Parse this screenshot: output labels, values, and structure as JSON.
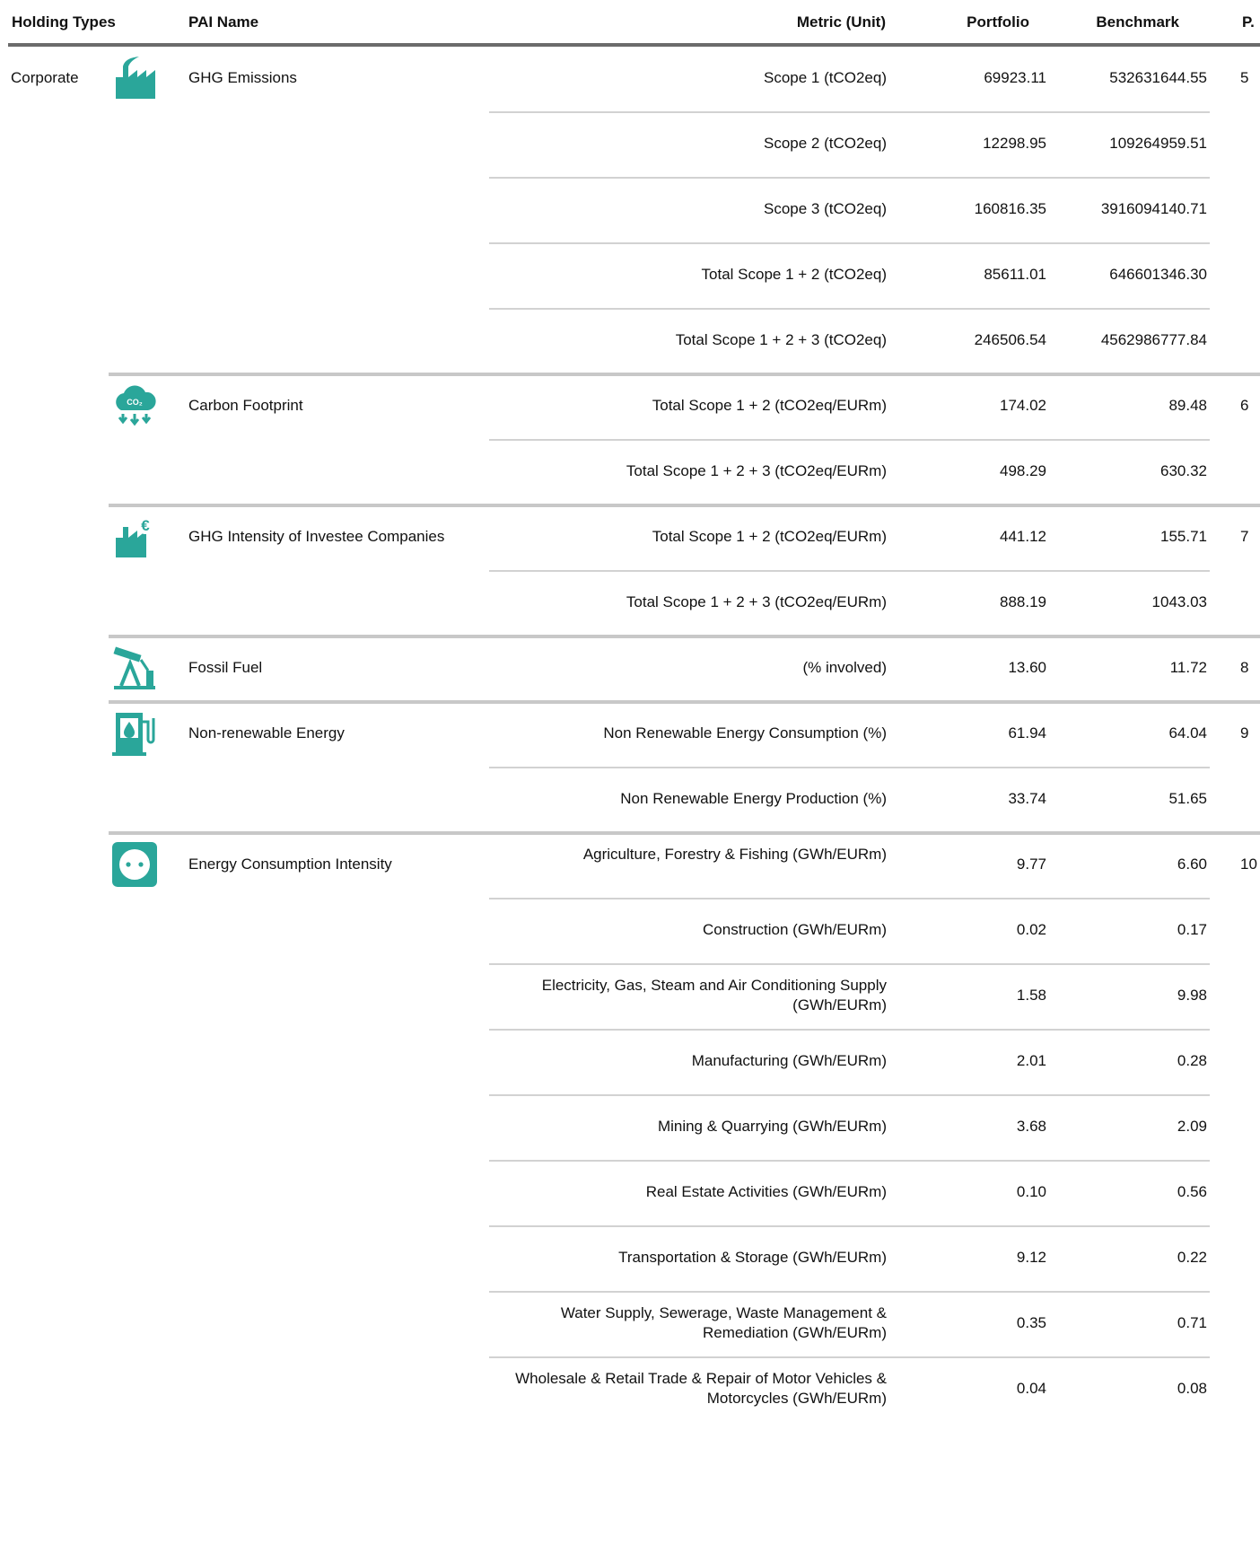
{
  "colors": {
    "teal": "#2aa69a",
    "header_rule": "#6b6b6b",
    "row_rule": "#d2d2d2"
  },
  "header": {
    "holding_types": "Holding Types",
    "pai_name": "PAI Name",
    "metric_unit": "Metric (Unit)",
    "portfolio": "Portfolio",
    "benchmark": "Benchmark",
    "page": "P."
  },
  "groups": [
    {
      "holding_type": "Corporate",
      "icon": "factory-emissions-icon",
      "pai_name": "GHG Emissions",
      "page": "5",
      "rows": [
        {
          "metric": "Scope 1 (tCO2eq)",
          "portfolio": "69923.11",
          "benchmark": "532631644.55"
        },
        {
          "metric": "Scope 2 (tCO2eq)",
          "portfolio": "12298.95",
          "benchmark": "109264959.51"
        },
        {
          "metric": "Scope 3 (tCO2eq)",
          "portfolio": "160816.35",
          "benchmark": "3916094140.71"
        },
        {
          "metric": "Total Scope 1 + 2 (tCO2eq)",
          "portfolio": "85611.01",
          "benchmark": "646601346.30"
        },
        {
          "metric": "Total Scope 1 + 2 + 3 (tCO2eq)",
          "portfolio": "246506.54",
          "benchmark": "4562986777.84"
        }
      ]
    },
    {
      "holding_type": "",
      "icon": "co2-cloud-icon",
      "pai_name": "Carbon Footprint",
      "page": "6",
      "rows": [
        {
          "metric": "Total Scope 1 + 2 (tCO2eq/EURm)",
          "portfolio": "174.02",
          "benchmark": "89.48"
        },
        {
          "metric": "Total Scope 1 + 2 + 3 (tCO2eq/EURm)",
          "portfolio": "498.29",
          "benchmark": "630.32"
        }
      ]
    },
    {
      "holding_type": "",
      "icon": "factory-euro-icon",
      "pai_name": "GHG Intensity of Investee Companies",
      "page": "7",
      "rows": [
        {
          "metric": "Total Scope 1 + 2 (tCO2eq/EURm)",
          "portfolio": "441.12",
          "benchmark": "155.71"
        },
        {
          "metric": "Total Scope 1 + 2 + 3 (tCO2eq/EURm)",
          "portfolio": "888.19",
          "benchmark": "1043.03"
        }
      ]
    },
    {
      "holding_type": "",
      "icon": "oil-pump-icon",
      "pai_name": "Fossil Fuel",
      "page": "8",
      "rows": [
        {
          "metric": "(% involved)",
          "portfolio": "13.60",
          "benchmark": "11.72"
        }
      ]
    },
    {
      "holding_type": "",
      "icon": "fuel-station-icon",
      "pai_name": "Non-renewable Energy",
      "page": "9",
      "rows": [
        {
          "metric": "Non Renewable Energy Consumption (%)",
          "portfolio": "61.94",
          "benchmark": "64.04"
        },
        {
          "metric": "Non Renewable Energy Production (%)",
          "portfolio": "33.74",
          "benchmark": "51.65"
        }
      ]
    },
    {
      "holding_type": "",
      "icon": "power-socket-icon",
      "pai_name": "Energy Consumption Intensity",
      "page": "10",
      "rows": [
        {
          "metric": "Agriculture, Forestry & Fishing (GWh/EURm)",
          "portfolio": "9.77",
          "benchmark": "6.60"
        },
        {
          "metric": "Construction (GWh/EURm)",
          "portfolio": "0.02",
          "benchmark": "0.17"
        },
        {
          "metric": "Electricity, Gas, Steam and Air Conditioning Supply (GWh/EURm)",
          "portfolio": "1.58",
          "benchmark": "9.98"
        },
        {
          "metric": "Manufacturing (GWh/EURm)",
          "portfolio": "2.01",
          "benchmark": "0.28"
        },
        {
          "metric": "Mining & Quarrying (GWh/EURm)",
          "portfolio": "3.68",
          "benchmark": "2.09"
        },
        {
          "metric": "Real Estate Activities (GWh/EURm)",
          "portfolio": "0.10",
          "benchmark": "0.56"
        },
        {
          "metric": "Transportation & Storage (GWh/EURm)",
          "portfolio": "9.12",
          "benchmark": "0.22"
        },
        {
          "metric": "Water Supply, Sewerage, Waste Management & Remediation (GWh/EURm)",
          "portfolio": "0.35",
          "benchmark": "0.71"
        },
        {
          "metric": "Wholesale & Retail Trade & Repair of Motor Vehicles & Motorcycles (GWh/EURm)",
          "portfolio": "0.04",
          "benchmark": "0.08"
        }
      ]
    }
  ]
}
